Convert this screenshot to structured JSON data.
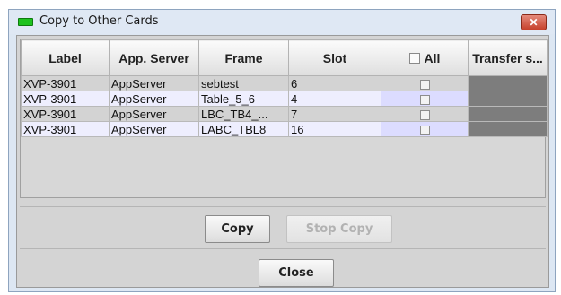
{
  "window": {
    "title": "Copy to Other Cards",
    "close_glyph": "✕"
  },
  "table": {
    "columns": [
      "Label",
      "App. Server",
      "Frame",
      "Slot",
      "All",
      "Transfer s..."
    ],
    "rows": [
      {
        "label": "XVP-3901",
        "server": "AppServer",
        "frame": "sebtest",
        "slot": "6",
        "checked": false
      },
      {
        "label": "XVP-3901",
        "server": "AppServer",
        "frame": "Table_5_6",
        "slot": "4",
        "checked": false
      },
      {
        "label": "XVP-3901",
        "server": "AppServer",
        "frame": "LBC_TB4_...",
        "slot": "7",
        "checked": false
      },
      {
        "label": "XVP-3901",
        "server": "AppServer",
        "frame": "LABC_TBL8",
        "slot": "16",
        "checked": false
      }
    ]
  },
  "buttons": {
    "copy": "Copy",
    "stop_copy": "Stop Copy",
    "close": "Close"
  },
  "colors": {
    "title_icon": "#1ec21e",
    "close_button": "#c6412c",
    "transfer_status_cell": "#7d7d7d"
  }
}
